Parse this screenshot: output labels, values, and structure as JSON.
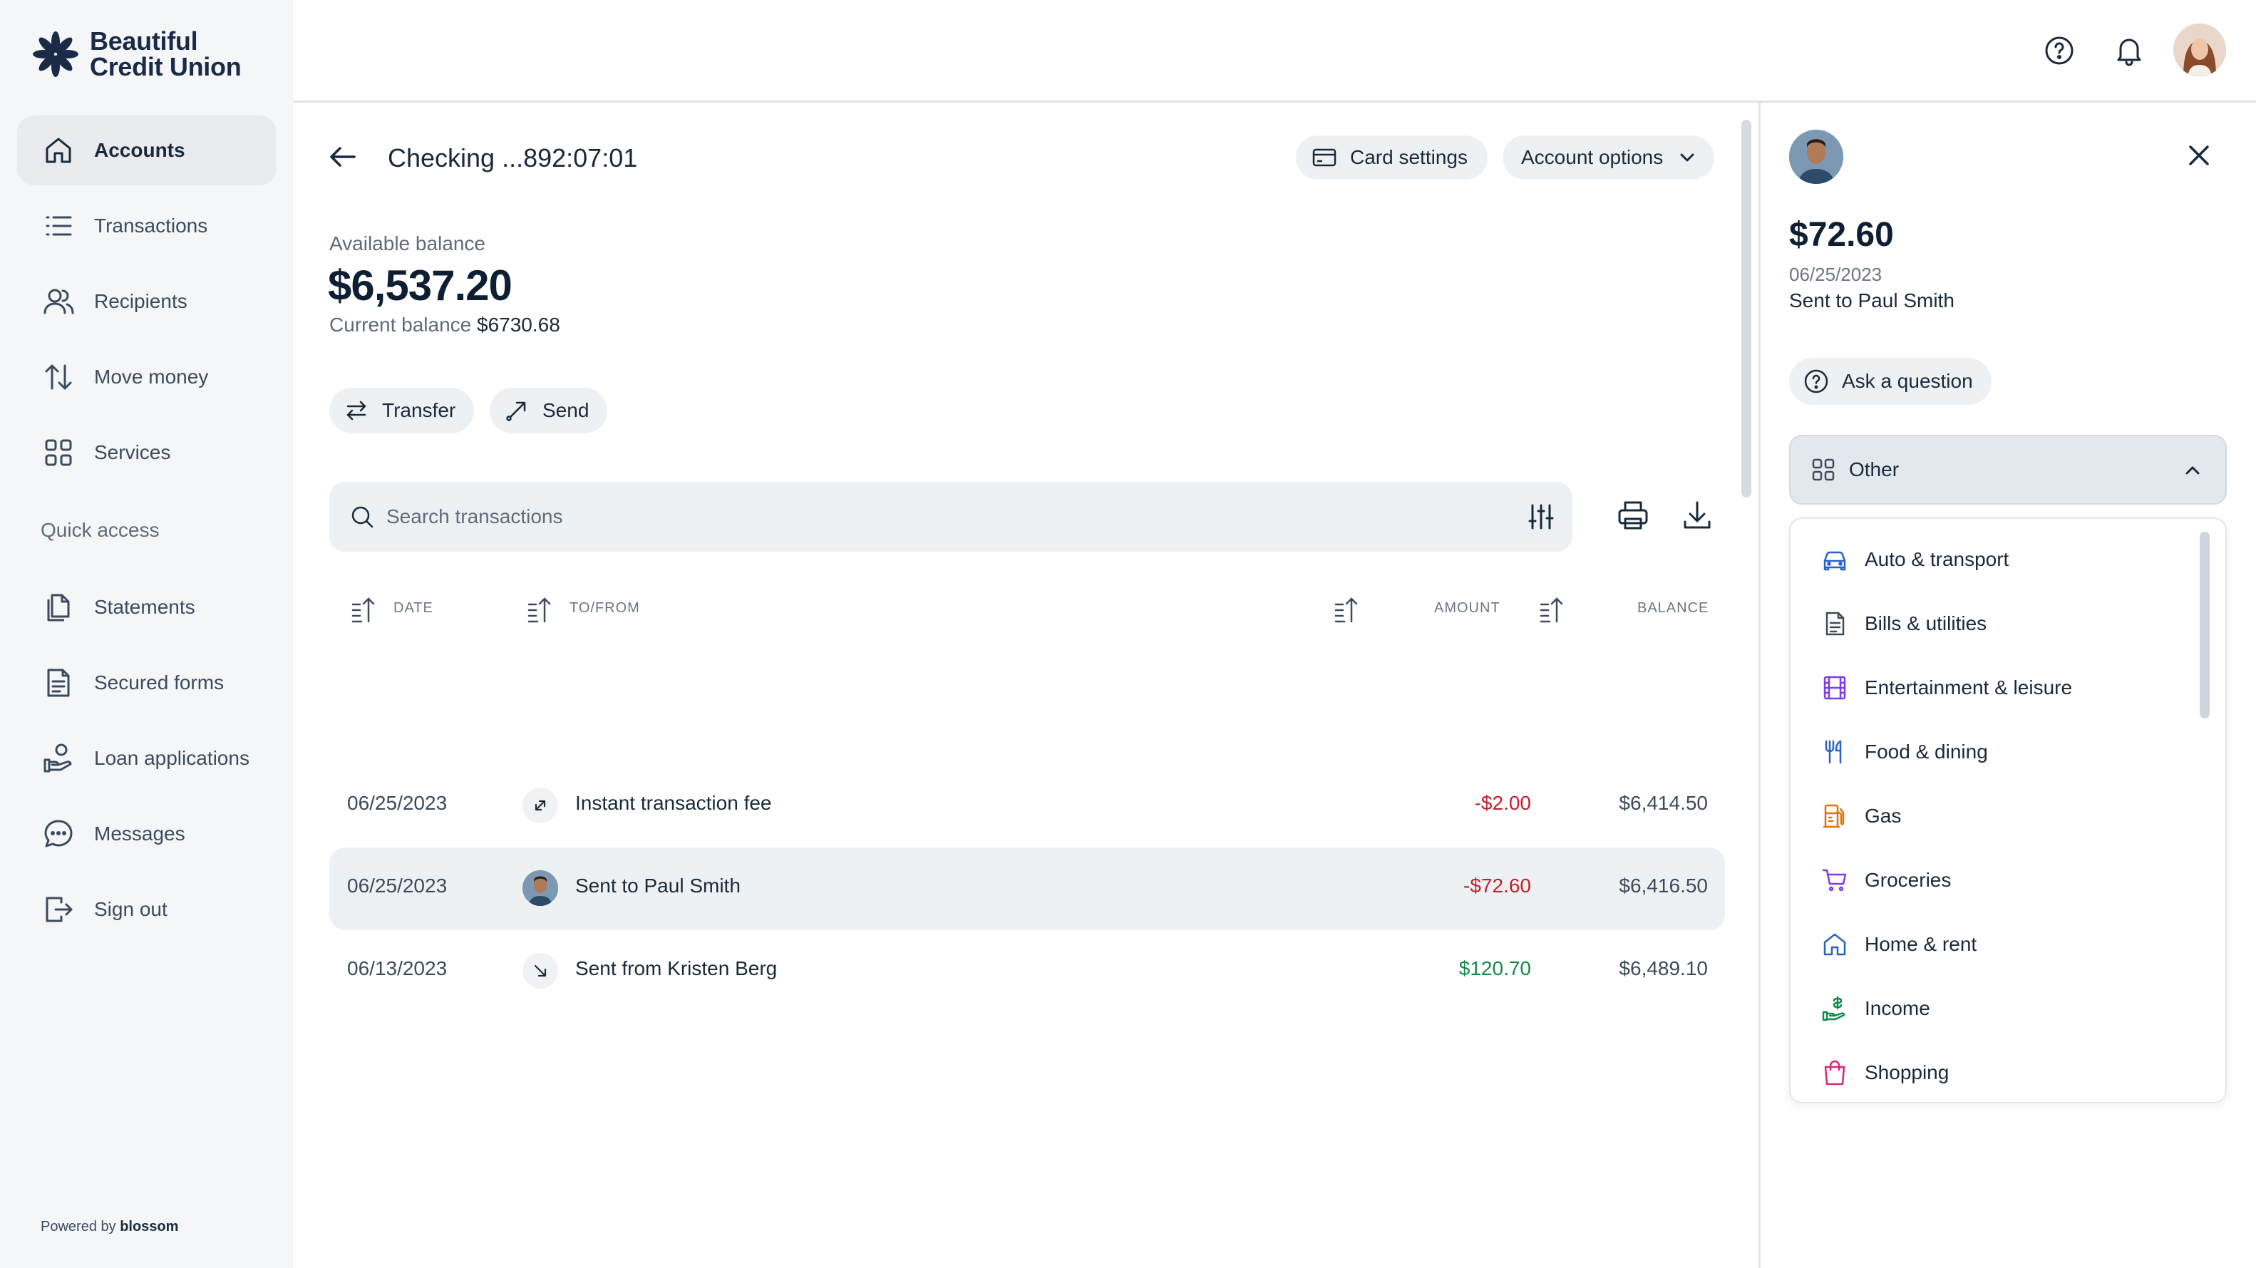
{
  "brand": {
    "line1": "Beautiful",
    "line2": "Credit Union",
    "powered_prefix": "Powered by",
    "powered_brand": "blossom"
  },
  "sidebar": {
    "items": [
      {
        "label": "Accounts",
        "icon": "home-icon"
      },
      {
        "label": "Transactions",
        "icon": "list-icon"
      },
      {
        "label": "Recipients",
        "icon": "users-icon"
      },
      {
        "label": "Move money",
        "icon": "arrows-updown-icon"
      },
      {
        "label": "Services",
        "icon": "grid-icon"
      }
    ],
    "section_label": "Quick access",
    "quick_items": [
      {
        "label": "Statements",
        "icon": "documents-icon"
      },
      {
        "label": "Secured forms",
        "icon": "form-icon"
      },
      {
        "label": "Loan applications",
        "icon": "hand-coin-icon"
      },
      {
        "label": "Messages",
        "icon": "chat-icon"
      },
      {
        "label": "Sign out",
        "icon": "sign-out-icon"
      }
    ]
  },
  "account": {
    "title": "Checking ...892:07:01",
    "card_settings": "Card settings",
    "account_options": "Account options",
    "available_label": "Available balance",
    "available_amount": "$6,537.20",
    "current_label": "Current balance",
    "current_amount": "$6730.68",
    "transfer_label": "Transfer",
    "send_label": "Send"
  },
  "search": {
    "placeholder": "Search transactions"
  },
  "table": {
    "headers": {
      "date": "DATE",
      "to_from": "TO/FROM",
      "amount": "AMOUNT",
      "balance": "BALANCE"
    },
    "rows": [
      {
        "date": "06/25/2023",
        "name": "Instant transaction fee",
        "amount": "-$2.00",
        "balance": "$6,414.50",
        "type": "negative"
      },
      {
        "date": "06/25/2023",
        "name": "Sent to Paul Smith",
        "amount": "-$72.60",
        "balance": "$6,416.50",
        "type": "negative"
      },
      {
        "date": "06/13/2023",
        "name": "Sent from Kristen Berg",
        "amount": "$120.70",
        "balance": "$6,489.10",
        "type": "positive"
      }
    ]
  },
  "detail": {
    "amount": "$72.60",
    "date": "06/25/2023",
    "description": "Sent to Paul Smith",
    "ask_label": "Ask a question",
    "category_selected": "Other",
    "categories": [
      {
        "label": "Auto & transport",
        "icon": "car-icon",
        "color": "#2563c9"
      },
      {
        "label": "Bills & utilities",
        "icon": "bill-icon",
        "color": "#3c4a5c"
      },
      {
        "label": "Entertainment & leisure",
        "icon": "film-icon",
        "color": "#7c3aed"
      },
      {
        "label": "Food & dining",
        "icon": "utensils-icon",
        "color": "#2563c9"
      },
      {
        "label": "Gas",
        "icon": "gas-pump-icon",
        "color": "#d97706"
      },
      {
        "label": "Groceries",
        "icon": "cart-icon",
        "color": "#7c3aed"
      },
      {
        "label": "Home & rent",
        "icon": "house-icon",
        "color": "#2563c9"
      },
      {
        "label": "Income",
        "icon": "income-icon",
        "color": "#138a4a"
      },
      {
        "label": "Shopping",
        "icon": "bag-icon",
        "color": "#db2777"
      }
    ]
  },
  "colors": {
    "negative": "#c41e2a",
    "positive": "#138a4a",
    "accent": "#1a2a47"
  }
}
